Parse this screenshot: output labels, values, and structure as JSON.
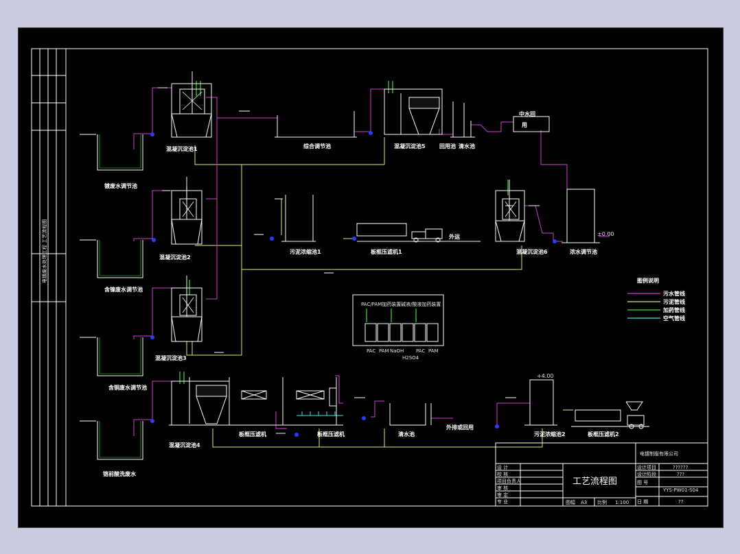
{
  "colors": {
    "background": "#c9cbe0",
    "sheet": "#000000",
    "wall": "#ffffff",
    "sewage_pipe": "#d23fd2",
    "sludge_pipe": "#e8e87a",
    "dosing_pipe": "#3ee03e",
    "air_pipe": "#3ee6e6",
    "pump": "#2a3cff"
  },
  "tanks": {
    "t1": "镀废水调节池",
    "t2": "含镍废水调节池",
    "t3": "含铜废水调节池",
    "t4": "铬前酸洗废水",
    "s1": "混凝沉淀池1",
    "s2": "混凝沉淀池2",
    "s3": "混凝沉淀池3",
    "s4": "混凝沉淀池4",
    "s5": "混凝沉淀池5",
    "s6": "混凝沉淀池6",
    "mix": "综合调节池",
    "reuse": "回用池",
    "clear1": "清水池",
    "clear2": "清水池",
    "thick1": "污泥浓缩池1",
    "press1": "板框压滤机1",
    "outbound": "外运",
    "conc": "浓水调节池",
    "reclaim": "中水回",
    "reclaim2": "用",
    "press_a": "板框压滤机",
    "press_b": "板框压滤机",
    "discharge": "外排或回用",
    "thick2": "污泥浓缩池2",
    "press2": "板框压滤机2",
    "level": "+4.00",
    "level2": "±0.00"
  },
  "legend": {
    "title": "图例说明",
    "items": [
      "污水管线",
      "污泥管线",
      "加药管线",
      "空气管线"
    ]
  },
  "panel": {
    "top": [
      "PAC/PAM加药装置",
      "碱液/酸液加药装置"
    ],
    "bottom": [
      "PAC",
      "PAM",
      "NaOH",
      "H2SO4",
      "PAC",
      "PAM"
    ]
  },
  "title_block": {
    "company": "电镀制版有限公司",
    "drawing_title": "工艺流程图",
    "left_labels": [
      "设 计",
      "校 核",
      "项目负责人",
      "审 核",
      "审 定",
      "专 业"
    ],
    "design_project_label": "设计项目",
    "design_project_value": "??????",
    "design_stage_label": "设计阶段",
    "design_stage_value": "???",
    "drawing_no_label": "图 号",
    "drawing_no_value": "YYS-PW01-S04",
    "date_label": "日 期",
    "date_value": "??",
    "scale_label": "比例",
    "scale_value": "1:100",
    "sheet_label": "图幅",
    "sheet_value": "A3"
  },
  "margin_note": "电镀废水处理工程 工艺流程图"
}
